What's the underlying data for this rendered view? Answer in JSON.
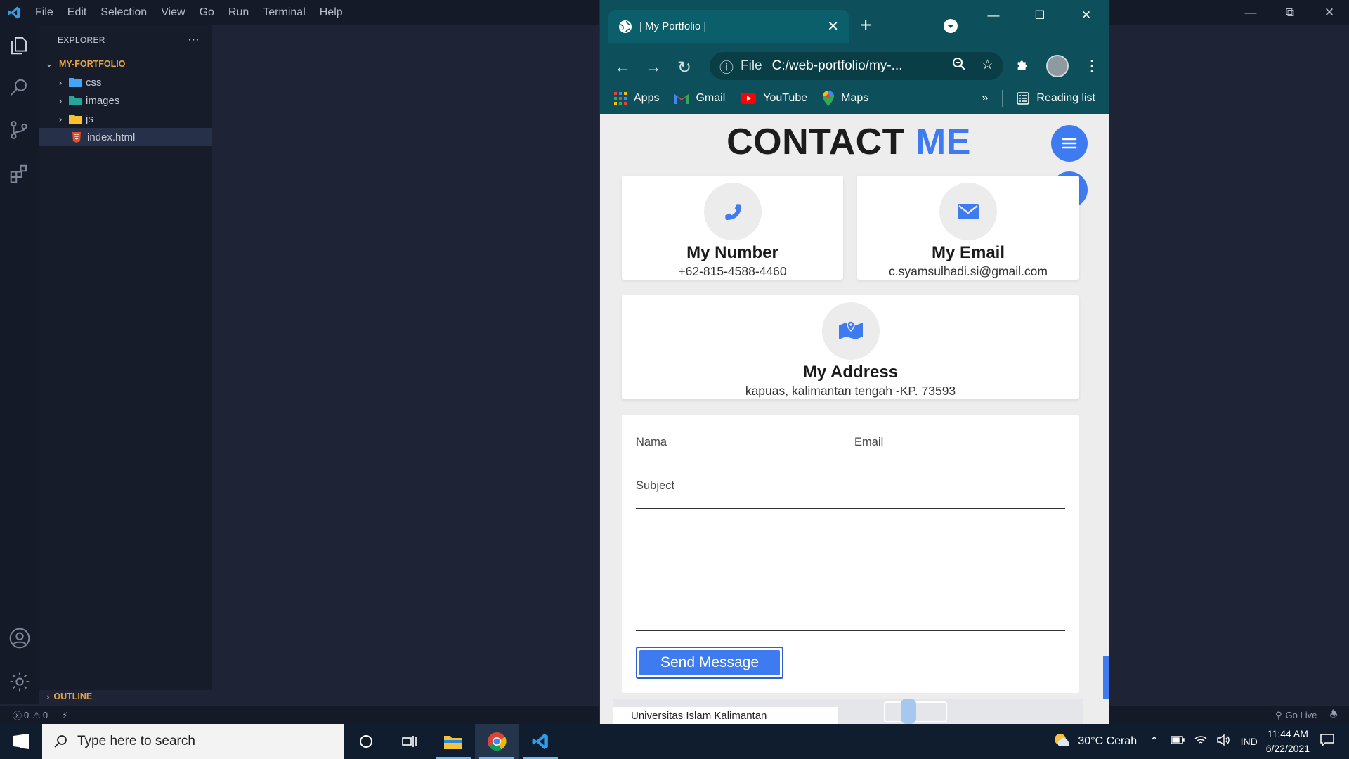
{
  "vscode": {
    "menu": [
      "File",
      "Edit",
      "Selection",
      "View",
      "Go",
      "Run",
      "Terminal",
      "Help"
    ],
    "explorer_title": "EXPLORER",
    "explorer_more": "···",
    "root_folder": "MY-FORTFOLIO",
    "tree": [
      {
        "label": "css",
        "type": "folder",
        "icon_color": "#42a5f5"
      },
      {
        "label": "images",
        "type": "folder",
        "icon_color": "#26a69a"
      },
      {
        "label": "js",
        "type": "folder",
        "icon_color": "#fbc02d"
      },
      {
        "label": "index.html",
        "type": "file",
        "icon_color": "#e44d26"
      }
    ],
    "outline_label": "OUTLINE",
    "status": {
      "errors": "0",
      "warnings": "0",
      "go_live": "Go Live"
    }
  },
  "browser": {
    "tab_title": "| My Portfolio |",
    "omnibox_scheme": "File",
    "omnibox_url": "C:/web-portfolio/my-...",
    "bookmarks": [
      "Apps",
      "Gmail",
      "YouTube",
      "Maps"
    ],
    "reading_list": "Reading list"
  },
  "page": {
    "title_main": "CONTACT",
    "title_accent": "ME",
    "accent_color": "#3f7bf0",
    "cards": [
      {
        "title": "My Number",
        "value": "+62-815-4588-4460",
        "icon": "phone-icon"
      },
      {
        "title": "My Email",
        "value": "c.syamsulhadi.si@gmail.com",
        "icon": "envelope-icon"
      },
      {
        "title": "My Address",
        "value": "kapuas, kalimantan tengah -KP. 73593",
        "icon": "map-icon"
      }
    ],
    "form": {
      "name_placeholder": "Nama",
      "email_placeholder": "Email",
      "subject_placeholder": "Subject",
      "send_label": "Send Message"
    },
    "map_label": "Universitas Islam Kalimantan"
  },
  "taskbar": {
    "search_placeholder": "Type here to search",
    "weather": "30°C Cerah",
    "language": "IND",
    "time": "11:44 AM",
    "date": "6/22/2021"
  }
}
